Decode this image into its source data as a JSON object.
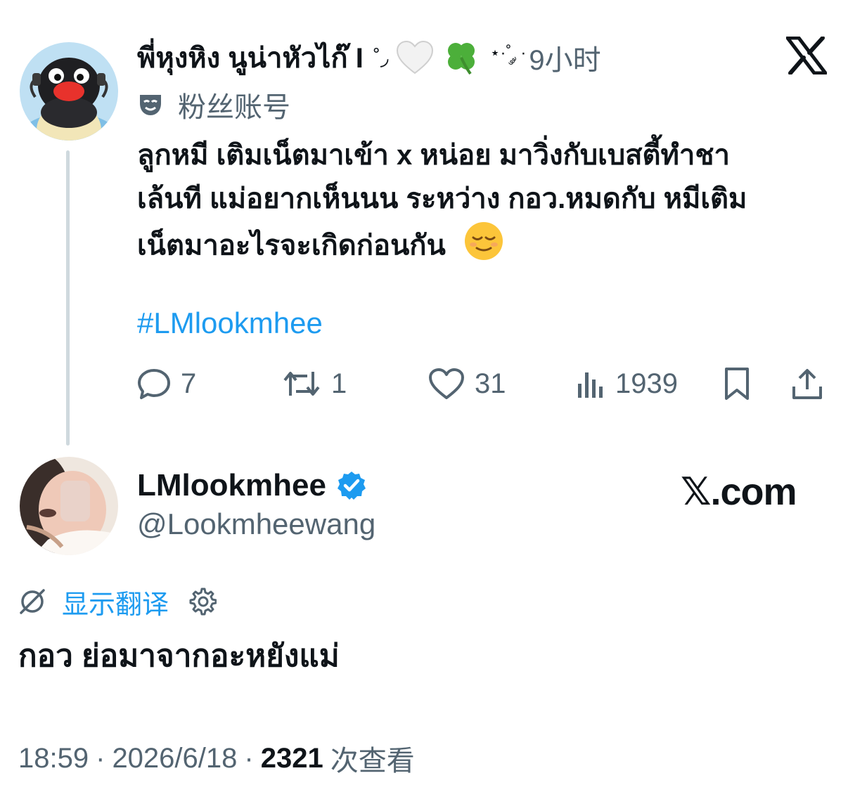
{
  "parent": {
    "display_name": "พี่หุงหิง นูน่าหัวไก๊ I",
    "name_deco": "˚◞",
    "emoji_1": "heart-white-icon",
    "emoji_2": "four-leaf-clover-icon",
    "name_dots": "⋆·˚ ༘ ·",
    "time": "9小时",
    "account_label": "粉丝账号",
    "text_lines": [
      "ลูกหมี เติมเน็ตมาเข้า x หน่อย มาวิ่งกับเบสตี้ทำชา",
      "เล้นที แม่อยากเห็นนน ระหว่าง กอว.หมดกับ หมีเติม",
      "เน็ตมาอะไรจะเกิดก่อนกัน"
    ],
    "text_emoji": "relieved-face-icon",
    "hashtag": "#LMlookmhee",
    "counts": {
      "replies": "7",
      "reposts": "1",
      "likes": "31",
      "views": "1939"
    }
  },
  "main": {
    "display_name": "LMlookmhee",
    "handle": "@Lookmheewang",
    "watermark": "𝕏.com",
    "translate_label": "显示翻译",
    "text": "กอว ย่อมาจากอะหยังแม่",
    "time": "18:59",
    "date": "2026/6/18",
    "separator": "·",
    "view_count": "2321",
    "view_label": "次查看"
  },
  "colors": {
    "text": "#0f1419",
    "secondary": "#536471",
    "link": "#1d9bf0",
    "thread_line": "#cfd9de"
  }
}
